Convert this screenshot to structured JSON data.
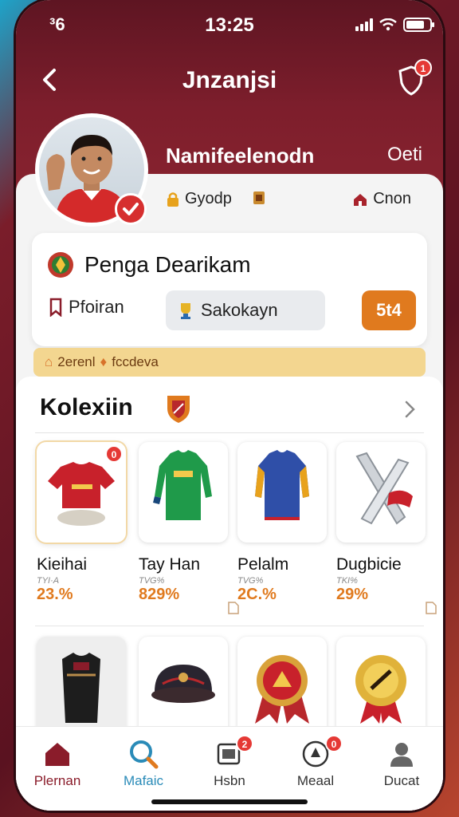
{
  "status_bar": {
    "left": "³6",
    "time": "13:25"
  },
  "header": {
    "title": "Jnzanjsi",
    "notification_count": "1"
  },
  "profile": {
    "name": "Namifeelenodn",
    "extra": "Oeti"
  },
  "stats": [
    {
      "label": "Gyodp"
    },
    {
      "label": ""
    },
    {
      "label": "Cnon"
    }
  ],
  "league": {
    "title": "Penga Dearikam",
    "profile_button": "Pfoiran",
    "search_value": "Sakokayn",
    "action_button": "5t4"
  },
  "info_strip": {
    "part1": "2erenl",
    "part2": "fccdeva"
  },
  "collection": {
    "title": "Kolexiin",
    "items": [
      {
        "name": "Kieihai",
        "sub": "TYI·A",
        "percent": "23.%",
        "badge": "0",
        "icon": "jersey-red-icon"
      },
      {
        "name": "Tay Han",
        "sub": "TVG%",
        "percent": "829%",
        "icon": "kit-green-icon"
      },
      {
        "name": "Pelalm",
        "sub": "TVG%",
        "percent": "2C.%",
        "icon": "kit-blue-icon"
      },
      {
        "name": "Dugbicie",
        "sub": "TKI%",
        "percent": "29%",
        "icon": "trophy-horn-icon"
      }
    ],
    "items_row2": [
      {
        "icon": "vest-icon"
      },
      {
        "icon": "helmet-icon"
      },
      {
        "icon": "medal-icon"
      },
      {
        "icon": "badge-icon"
      }
    ]
  },
  "tabs": [
    {
      "label": "Plernan",
      "icon": "home-icon"
    },
    {
      "label": "Mafaic",
      "icon": "search-icon"
    },
    {
      "label": "Hsbn",
      "icon": "cards-icon",
      "badge": "2"
    },
    {
      "label": "Meaal",
      "icon": "medal-tab-icon",
      "badge": "0"
    },
    {
      "label": "Ducat",
      "icon": "profile-icon"
    }
  ],
  "colors": {
    "primary": "#7d1e2c",
    "accent": "#e07a1e",
    "strip": "#f3d690"
  }
}
